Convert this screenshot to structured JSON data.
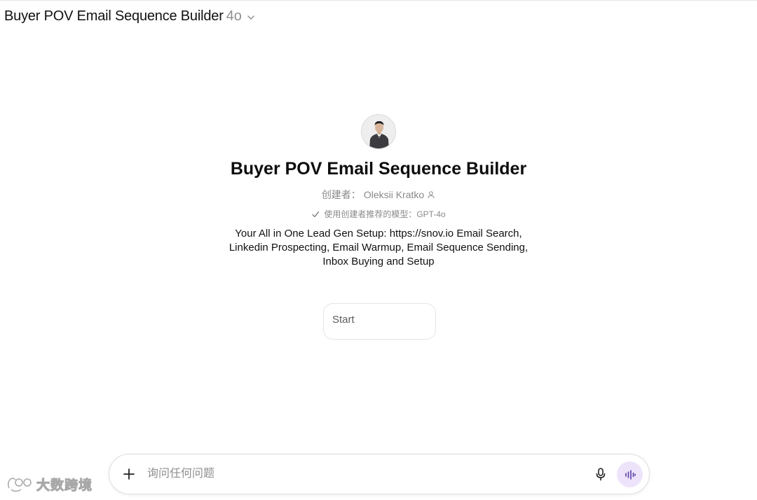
{
  "header": {
    "title": "Buyer POV Email Sequence Builder",
    "model": "4o",
    "dropdown_icon": "chevron-down-icon"
  },
  "profile": {
    "avatar_icon": "avatar-portrait",
    "name": "Buyer POV Email Sequence Builder",
    "creator_label": "创建者：",
    "creator_name": "Oleksii Kratko",
    "creator_icon": "person-icon",
    "model_recommendation": "使用创建者推荐的模型：GPT-4o",
    "check_icon": "check-icon",
    "description": "Your All in One Lead Gen Setup: https://snov.io Email Search, Linkedin Prospecting, Email Warmup, Email Sequence Sending, Inbox Buying and Setup"
  },
  "starters": [
    {
      "label": "Start"
    }
  ],
  "composer": {
    "placeholder": "询问任何问题",
    "value": "",
    "plus_icon": "plus-icon",
    "mic_icon": "microphone-icon",
    "voice_icon": "voice-mode-icon",
    "voice_button_color": "#ede4fb"
  },
  "watermark": {
    "text": "大数跨境"
  }
}
